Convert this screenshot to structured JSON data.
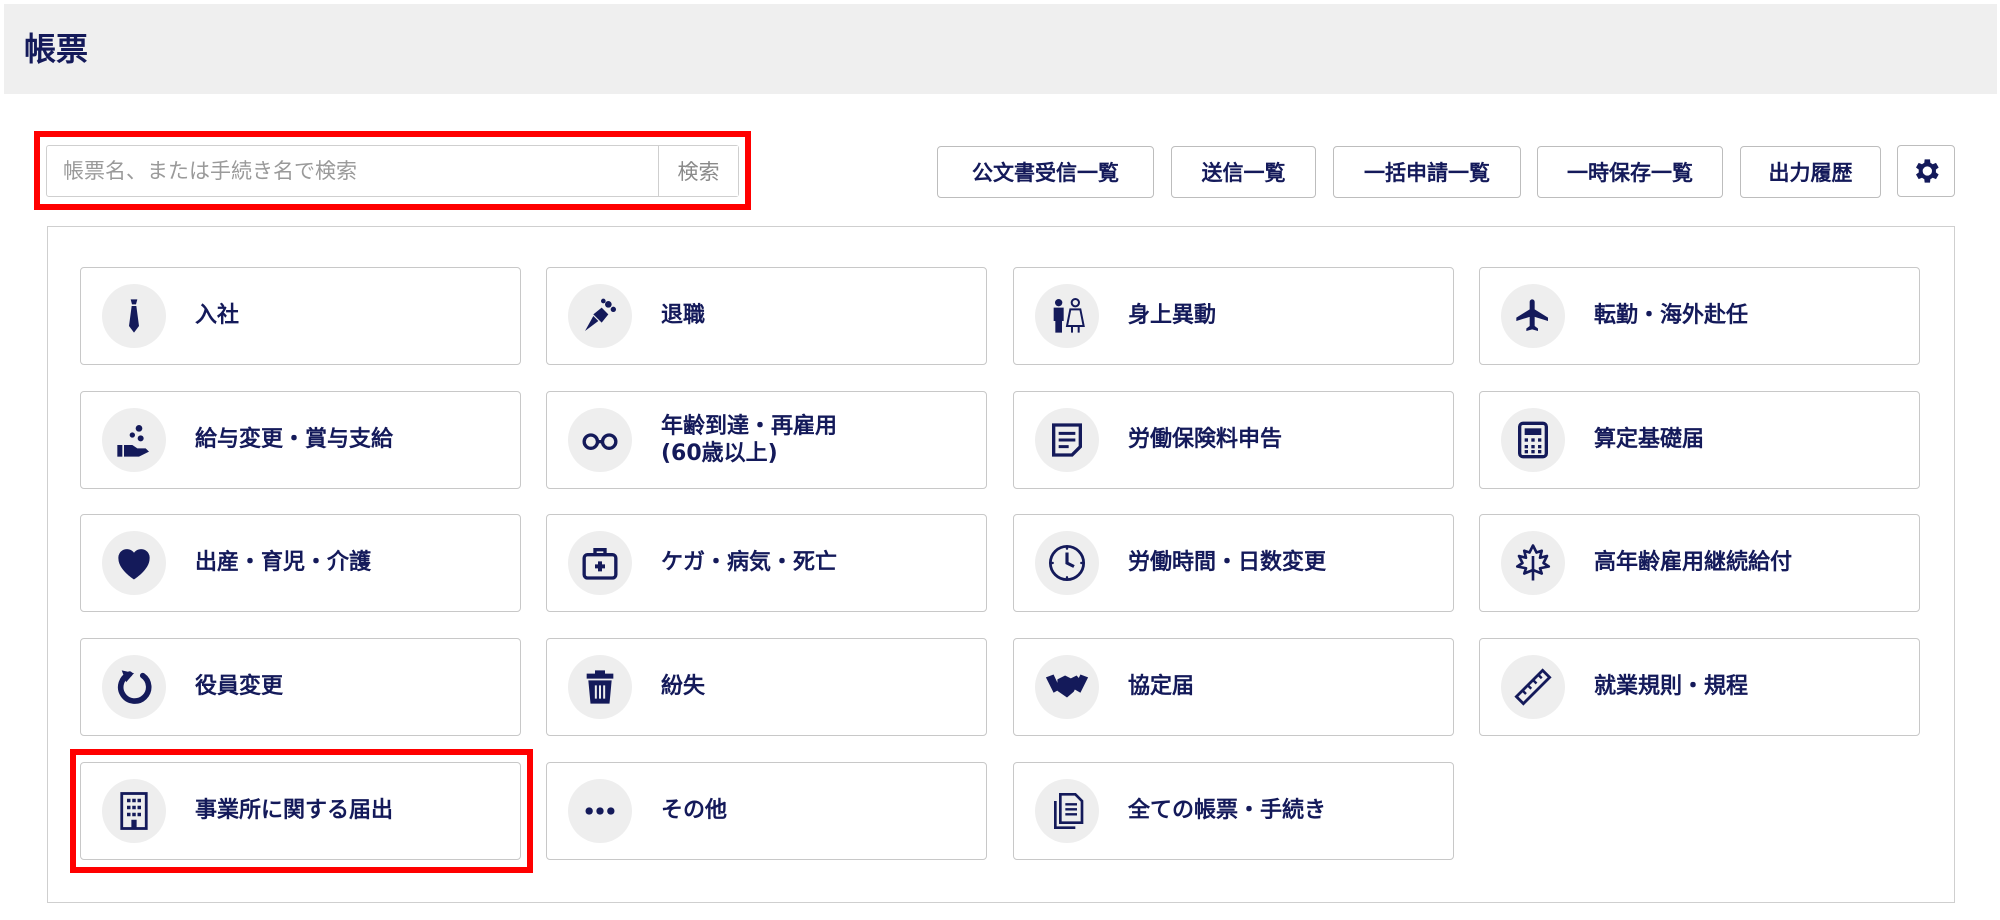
{
  "header": {
    "title": "帳票"
  },
  "search": {
    "placeholder": "帳票名、または手続き名で検索",
    "button": "検索"
  },
  "toolbar": {
    "buttons": [
      {
        "label": "公文書受信一覧"
      },
      {
        "label": "送信一覧"
      },
      {
        "label": "一括申請一覧"
      },
      {
        "label": "一時保存一覧"
      },
      {
        "label": "出力履歴"
      }
    ],
    "settings_icon": "gear-icon"
  },
  "categories": [
    {
      "label": "入社",
      "icon": "necktie-icon"
    },
    {
      "label": "退職",
      "icon": "bouquet-icon"
    },
    {
      "label": "身上異動",
      "icon": "wedding-couple-icon"
    },
    {
      "label": "転勤・海外赴任",
      "icon": "airplane-icon"
    },
    {
      "label": "給与変更・賞与支給",
      "icon": "hand-coins-icon"
    },
    {
      "label": "年齢到達・再雇用",
      "label2": "(60歳以上)",
      "icon": "glasses-icon"
    },
    {
      "label": "労働保険料申告",
      "icon": "document-icon"
    },
    {
      "label": "算定基礎届",
      "icon": "calculator-icon"
    },
    {
      "label": "出産・育児・介護",
      "icon": "heart-icon"
    },
    {
      "label": "ケガ・病気・死亡",
      "icon": "first-aid-kit-icon"
    },
    {
      "label": "労働時間・日数変更",
      "icon": "clock-icon"
    },
    {
      "label": "高年齢雇用継続給付",
      "icon": "maple-leaf-icon"
    },
    {
      "label": "役員変更",
      "icon": "refresh-icon"
    },
    {
      "label": "紛失",
      "icon": "trash-icon"
    },
    {
      "label": "協定届",
      "icon": "handshake-icon"
    },
    {
      "label": "就業規則・規程",
      "icon": "ruler-icon"
    },
    {
      "label": "事業所に関する届出",
      "icon": "building-icon"
    },
    {
      "label": "その他",
      "icon": "ellipsis-icon"
    },
    {
      "label": "全ての帳票・手続き",
      "icon": "documents-icon"
    }
  ],
  "colors": {
    "navy": "#141a5a",
    "highlight": "#ff0000",
    "header_bg": "#efefef"
  }
}
